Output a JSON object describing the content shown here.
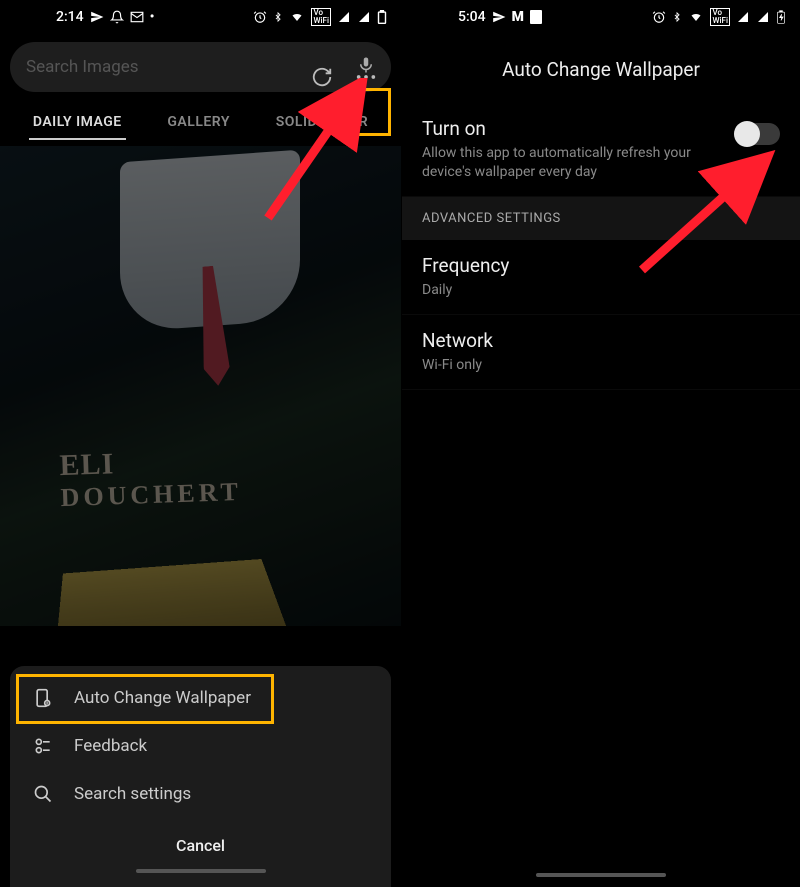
{
  "left": {
    "status_time": "2:14",
    "search_placeholder": "Search Images",
    "tabs": {
      "daily": "DAILY IMAGE",
      "gallery": "GALLERY",
      "solid": "SOLID COLOR"
    },
    "mural_sign_line1": "ELI",
    "mural_sign_line2": "DOUCHERT",
    "sheet": {
      "auto_change": "Auto Change Wallpaper",
      "feedback": "Feedback",
      "search_settings": "Search settings",
      "cancel": "Cancel"
    }
  },
  "right": {
    "status_time": "5:04",
    "header": "Auto Change Wallpaper",
    "turn_on": {
      "title": "Turn on",
      "sub": "Allow this app to automatically refresh your device's wallpaper every day"
    },
    "advanced_header": "ADVANCED SETTINGS",
    "frequency": {
      "title": "Frequency",
      "value": "Daily"
    },
    "network": {
      "title": "Network",
      "value": "Wi-Fi only"
    }
  },
  "annotation_color": "#ffb400",
  "arrow_color": "#ff1e2d"
}
